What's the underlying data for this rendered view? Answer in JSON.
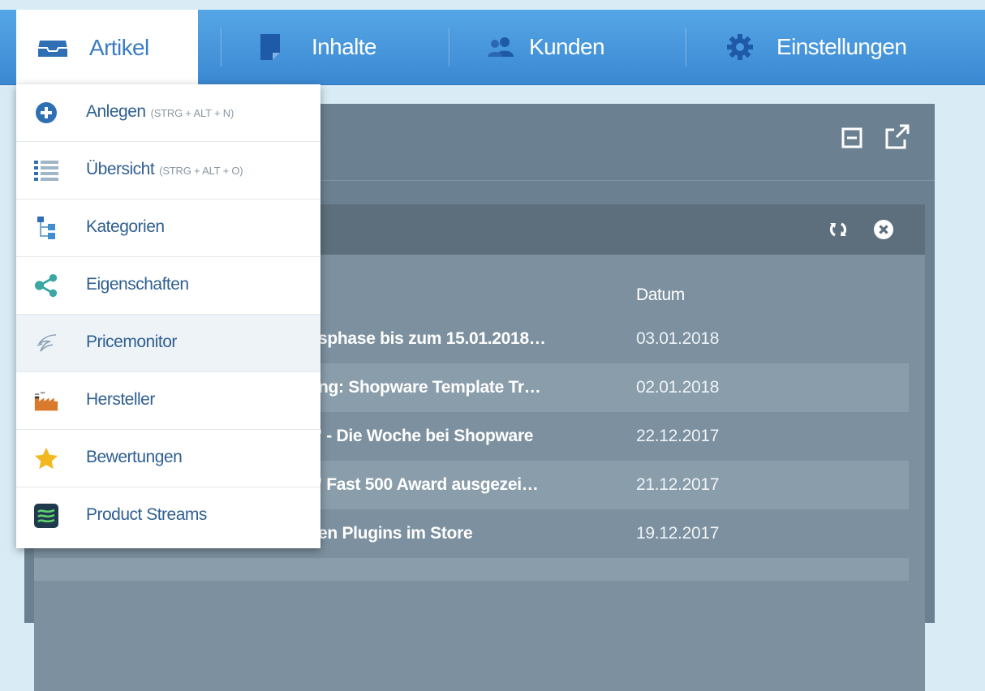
{
  "nav": {
    "tabs": [
      {
        "label": "Artikel",
        "icon": "inbox-icon"
      },
      {
        "label": "Inhalte",
        "icon": "document-icon"
      },
      {
        "label": "Kunden",
        "icon": "users-icon"
      },
      {
        "label": "Einstellungen",
        "icon": "gear-icon"
      }
    ]
  },
  "menu": {
    "items": [
      {
        "label": "Anlegen",
        "shortcut": "(STRG + ALT + N)",
        "icon": "plus-circle-icon"
      },
      {
        "label": "Übersicht",
        "shortcut": "(STRG + ALT + O)",
        "icon": "list-icon"
      },
      {
        "label": "Kategorien",
        "shortcut": "",
        "icon": "tree-icon"
      },
      {
        "label": "Eigenschaften",
        "shortcut": "",
        "icon": "share-icon"
      },
      {
        "label": "Pricemonitor",
        "shortcut": "",
        "icon": "pricemonitor-icon"
      },
      {
        "label": "Hersteller",
        "shortcut": "",
        "icon": "factory-icon"
      },
      {
        "label": "Bewertungen",
        "shortcut": "",
        "icon": "star-icon"
      },
      {
        "label": "Product Streams",
        "shortcut": "",
        "icon": "streams-icon"
      }
    ],
    "hovered_index": 4
  },
  "widget": {
    "column_date": "Datum",
    "rows": [
      {
        "title": "sphase bis zum 15.01.2018…",
        "date": "03.01.2018"
      },
      {
        "title": "ng: Shopware Template Tr…",
        "date": "02.01.2018"
      },
      {
        "title": "' - Die Woche bei Shopware",
        "date": "22.12.2017"
      },
      {
        "title": "' Fast 500 Award ausgezei…",
        "date": "21.12.2017"
      },
      {
        "title": "en Plugins im Store",
        "date": "19.12.2017"
      }
    ]
  },
  "colors": {
    "nav_blue": "#3b88d2",
    "menu_text": "#2f5f91",
    "window_bg": "#6b8090"
  }
}
